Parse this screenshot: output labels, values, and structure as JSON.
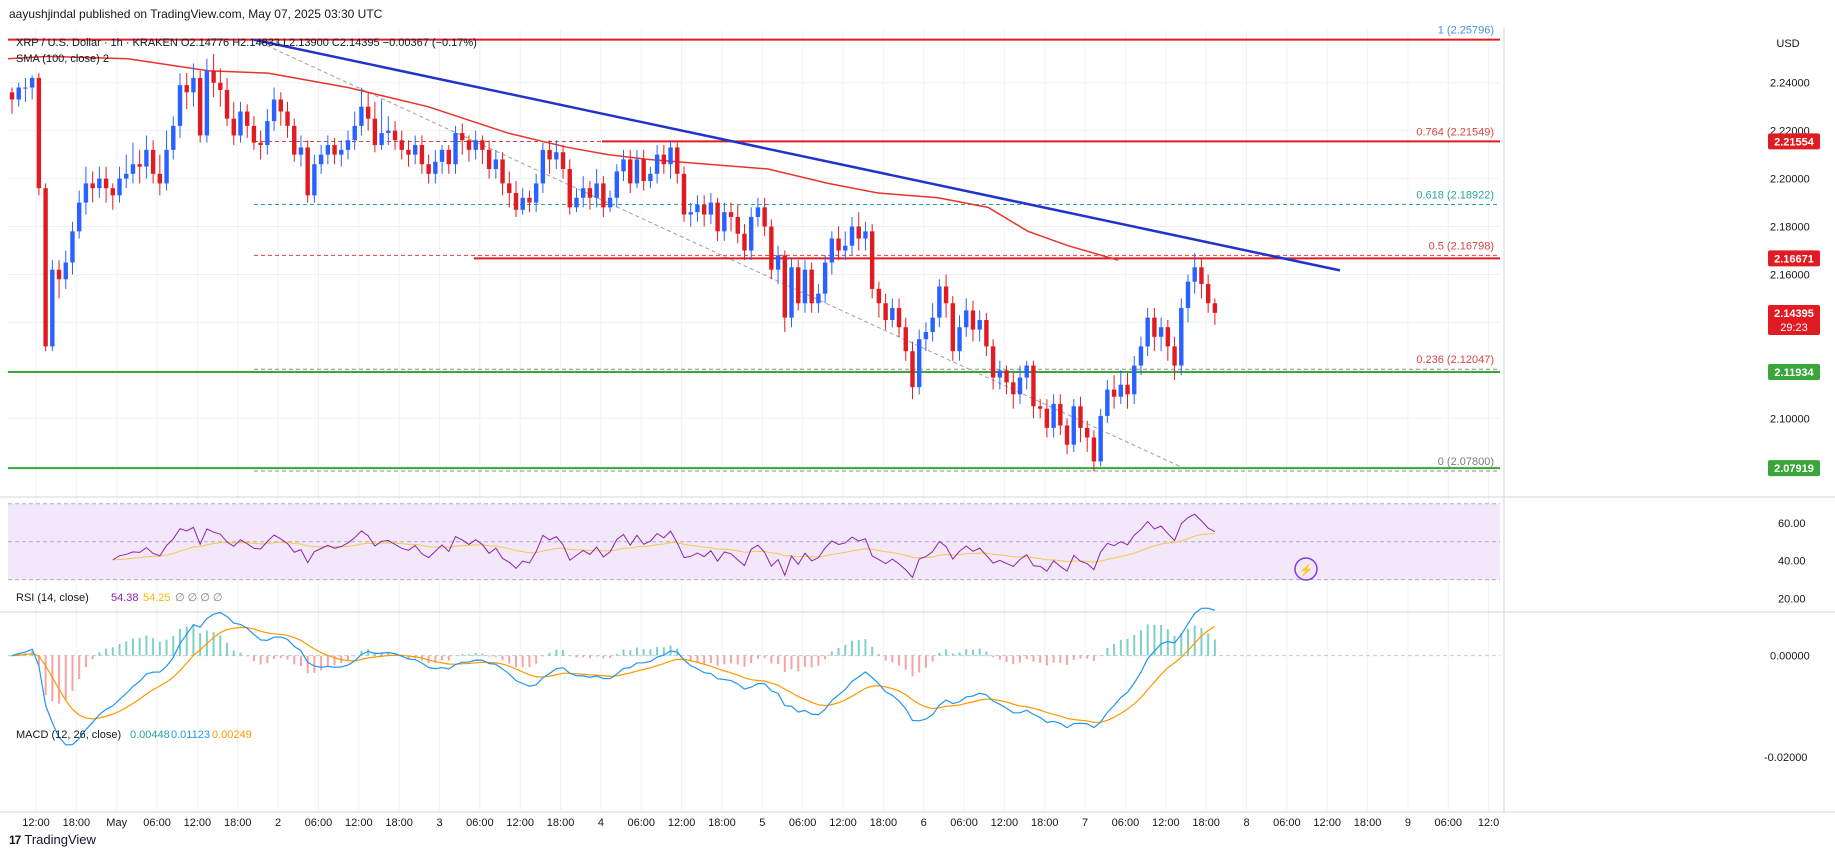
{
  "header": {
    "published": "aayushjindal published on TradingView.com, May 07, 2025 03:30 UTC"
  },
  "symbol_bar": {
    "pair": "XRP / U.S. Dollar · 1h · KRAKEN",
    "open": "O2.14776",
    "high": "H2.14833",
    "low": "L2.13900",
    "close": "C2.14395",
    "change": "−0.00367 (−0.17%)"
  },
  "sma_label": "SMA (100, close)  2",
  "rsi_label": {
    "name": "RSI (14, close)",
    "value": "54.38",
    "ma": "54.25",
    "extra": "∅ ∅ ∅ ∅"
  },
  "macd_label": {
    "name": "MACD (12, 26, close)",
    "v1": "0.00448",
    "v2": "0.01123",
    "v3": "0.00249"
  },
  "currency": "USD",
  "logo_text": "TradingView",
  "colors": {
    "up": "#2962ff",
    "down": "#e01b22",
    "sma": "#e8342b",
    "trend": "#2233cc",
    "resistance": "#e01b22",
    "support": "#3aa63a",
    "rsi_line": "#8e24aa",
    "rsi_ma": "#f2c94c",
    "macd_line": "#2196f3",
    "signal_line": "#ff9800",
    "fib": "#26a69a"
  },
  "chart_data": {
    "type": "candlestick",
    "title": "XRP / U.S. Dollar · 1h · KRAKEN",
    "ylim": [
      2.068,
      2.262
    ],
    "y_ticks": [
      "2.24000",
      "2.22000",
      "2.20000",
      "2.18000",
      "2.16000",
      "2.10000"
    ],
    "x_ticks": [
      "12:00",
      "18:00",
      "May",
      "06:00",
      "12:00",
      "18:00",
      "2",
      "06:00",
      "12:00",
      "18:00",
      "3",
      "06:00",
      "12:00",
      "18:00",
      "4",
      "06:00",
      "12:00",
      "18:00",
      "5",
      "06:00",
      "12:00",
      "18:00",
      "6",
      "06:00",
      "12:00",
      "18:00",
      "7",
      "06:00",
      "12:00",
      "18:00",
      "8",
      "06:00",
      "12:00",
      "18:00",
      "9",
      "06:00",
      "12:0"
    ],
    "candles": [
      [
        2.236,
        2.233,
        2.227,
        2.238
      ],
      [
        2.233,
        2.238,
        2.23,
        2.24
      ],
      [
        2.238,
        2.238,
        2.232,
        2.242
      ],
      [
        2.238,
        2.242,
        2.233,
        2.243
      ],
      [
        2.242,
        2.196,
        2.193,
        2.244
      ],
      [
        2.196,
        2.13,
        2.128,
        2.198
      ],
      [
        2.13,
        2.162,
        2.128,
        2.166
      ],
      [
        2.162,
        2.158,
        2.15,
        2.166
      ],
      [
        2.158,
        2.165,
        2.154,
        2.17
      ],
      [
        2.165,
        2.178,
        2.16,
        2.182
      ],
      [
        2.178,
        2.19,
        2.175,
        2.195
      ],
      [
        2.19,
        2.198,
        2.185,
        2.205
      ],
      [
        2.198,
        2.196,
        2.19,
        2.203
      ],
      [
        2.196,
        2.2,
        2.192,
        2.205
      ],
      [
        2.2,
        2.196,
        2.19,
        2.205
      ],
      [
        2.196,
        2.193,
        2.187,
        2.198
      ],
      [
        2.193,
        2.2,
        2.19,
        2.205
      ],
      [
        2.2,
        2.202,
        2.196,
        2.21
      ],
      [
        2.202,
        2.206,
        2.198,
        2.215
      ],
      [
        2.206,
        2.205,
        2.198,
        2.212
      ],
      [
        2.205,
        2.212,
        2.2,
        2.218
      ],
      [
        2.212,
        2.202,
        2.198,
        2.216
      ],
      [
        2.202,
        2.198,
        2.193,
        2.21
      ],
      [
        2.198,
        2.212,
        2.195,
        2.22
      ],
      [
        2.212,
        2.222,
        2.208,
        2.226
      ],
      [
        2.222,
        2.239,
        2.217,
        2.244
      ],
      [
        2.239,
        2.236,
        2.229,
        2.244
      ],
      [
        2.236,
        2.242,
        2.23,
        2.248
      ],
      [
        2.242,
        2.218,
        2.215,
        2.245
      ],
      [
        2.218,
        2.245,
        2.215,
        2.25
      ],
      [
        2.245,
        2.24,
        2.234,
        2.252
      ],
      [
        2.24,
        2.237,
        2.23,
        2.246
      ],
      [
        2.237,
        2.225,
        2.222,
        2.242
      ],
      [
        2.225,
        2.218,
        2.214,
        2.232
      ],
      [
        2.218,
        2.228,
        2.215,
        2.232
      ],
      [
        2.228,
        2.222,
        2.217,
        2.231
      ],
      [
        2.222,
        2.215,
        2.212,
        2.226
      ],
      [
        2.215,
        2.214,
        2.208,
        2.22
      ],
      [
        2.214,
        2.224,
        2.21,
        2.229
      ],
      [
        2.224,
        2.233,
        2.22,
        2.238
      ],
      [
        2.233,
        2.228,
        2.222,
        2.236
      ],
      [
        2.228,
        2.222,
        2.217,
        2.232
      ],
      [
        2.222,
        2.21,
        2.207,
        2.225
      ],
      [
        2.21,
        2.213,
        2.205,
        2.218
      ],
      [
        2.213,
        2.193,
        2.19,
        2.216
      ],
      [
        2.193,
        2.206,
        2.19,
        2.21
      ],
      [
        2.206,
        2.21,
        2.202,
        2.214
      ],
      [
        2.21,
        2.214,
        2.206,
        2.218
      ],
      [
        2.214,
        2.21,
        2.206,
        2.217
      ],
      [
        2.21,
        2.212,
        2.205,
        2.216
      ],
      [
        2.212,
        2.216,
        2.208,
        2.22
      ],
      [
        2.216,
        2.222,
        2.212,
        2.228
      ],
      [
        2.222,
        2.23,
        2.218,
        2.238
      ],
      [
        2.23,
        2.225,
        2.22,
        2.236
      ],
      [
        2.225,
        2.214,
        2.211,
        2.232
      ],
      [
        2.214,
        2.219,
        2.212,
        2.233
      ],
      [
        2.219,
        2.22,
        2.214,
        2.226
      ],
      [
        2.22,
        2.216,
        2.212,
        2.224
      ],
      [
        2.216,
        2.212,
        2.208,
        2.22
      ],
      [
        2.212,
        2.21,
        2.205,
        2.216
      ],
      [
        2.21,
        2.214,
        2.206,
        2.218
      ],
      [
        2.214,
        2.206,
        2.202,
        2.218
      ],
      [
        2.206,
        2.202,
        2.198,
        2.21
      ],
      [
        2.202,
        2.207,
        2.198,
        2.212
      ],
      [
        2.207,
        2.212,
        2.202,
        2.214
      ],
      [
        2.212,
        2.206,
        2.202,
        2.214
      ],
      [
        2.206,
        2.219,
        2.202,
        2.222
      ],
      [
        2.219,
        2.216,
        2.21,
        2.223
      ],
      [
        2.216,
        2.212,
        2.207,
        2.218
      ],
      [
        2.212,
        2.216,
        2.208,
        2.22
      ],
      [
        2.216,
        2.212,
        2.206,
        2.218
      ],
      [
        2.212,
        2.204,
        2.2,
        2.216
      ],
      [
        2.204,
        2.208,
        2.2,
        2.212
      ],
      [
        2.208,
        2.198,
        2.193,
        2.211
      ],
      [
        2.198,
        2.194,
        2.188,
        2.203
      ],
      [
        2.194,
        2.187,
        2.184,
        2.199
      ],
      [
        2.187,
        2.192,
        2.185,
        2.196
      ],
      [
        2.192,
        2.19,
        2.186,
        2.195
      ],
      [
        2.19,
        2.198,
        2.186,
        2.202
      ],
      [
        2.198,
        2.212,
        2.194,
        2.215
      ],
      [
        2.212,
        2.208,
        2.202,
        2.216
      ],
      [
        2.208,
        2.211,
        2.204,
        2.216
      ],
      [
        2.211,
        2.204,
        2.2,
        2.214
      ],
      [
        2.204,
        2.188,
        2.185,
        2.208
      ],
      [
        2.188,
        2.192,
        2.186,
        2.196
      ],
      [
        2.192,
        2.196,
        2.188,
        2.201
      ],
      [
        2.196,
        2.192,
        2.187,
        2.199
      ],
      [
        2.192,
        2.198,
        2.188,
        2.204
      ],
      [
        2.198,
        2.188,
        2.184,
        2.201
      ],
      [
        2.188,
        2.192,
        2.186,
        2.195
      ],
      [
        2.192,
        2.203,
        2.188,
        2.206
      ],
      [
        2.203,
        2.208,
        2.199,
        2.212
      ],
      [
        2.208,
        2.198,
        2.194,
        2.212
      ],
      [
        2.198,
        2.208,
        2.196,
        2.212
      ],
      [
        2.208,
        2.199,
        2.195,
        2.212
      ],
      [
        2.199,
        2.202,
        2.196,
        2.205
      ],
      [
        2.202,
        2.21,
        2.198,
        2.214
      ],
      [
        2.21,
        2.206,
        2.202,
        2.214
      ],
      [
        2.206,
        2.213,
        2.2,
        2.216
      ],
      [
        2.213,
        2.202,
        2.198,
        2.215
      ],
      [
        2.202,
        2.185,
        2.182,
        2.205
      ],
      [
        2.185,
        2.186,
        2.18,
        2.19
      ],
      [
        2.186,
        2.189,
        2.182,
        2.193
      ],
      [
        2.189,
        2.185,
        2.18,
        2.193
      ],
      [
        2.185,
        2.19,
        2.181,
        2.194
      ],
      [
        2.19,
        2.178,
        2.174,
        2.192
      ],
      [
        2.178,
        2.186,
        2.174,
        2.19
      ],
      [
        2.186,
        2.184,
        2.178,
        2.19
      ],
      [
        2.184,
        2.177,
        2.173,
        2.189
      ],
      [
        2.177,
        2.17,
        2.166,
        2.181
      ],
      [
        2.17,
        2.184,
        2.166,
        2.188
      ],
      [
        2.184,
        2.188,
        2.18,
        2.192
      ],
      [
        2.188,
        2.18,
        2.176,
        2.192
      ],
      [
        2.18,
        2.162,
        2.158,
        2.183
      ],
      [
        2.162,
        2.168,
        2.156,
        2.172
      ],
      [
        2.168,
        2.142,
        2.136,
        2.17
      ],
      [
        2.142,
        2.163,
        2.138,
        2.167
      ],
      [
        2.163,
        2.148,
        2.145,
        2.166
      ],
      [
        2.148,
        2.162,
        2.144,
        2.166
      ],
      [
        2.162,
        2.148,
        2.144,
        2.165
      ],
      [
        2.148,
        2.152,
        2.144,
        2.156
      ],
      [
        2.152,
        2.165,
        2.148,
        2.168
      ],
      [
        2.165,
        2.175,
        2.16,
        2.178
      ],
      [
        2.175,
        2.17,
        2.166,
        2.18
      ],
      [
        2.17,
        2.172,
        2.166,
        2.178
      ],
      [
        2.172,
        2.18,
        2.168,
        2.184
      ],
      [
        2.18,
        2.175,
        2.17,
        2.186
      ],
      [
        2.175,
        2.178,
        2.17,
        2.182
      ],
      [
        2.178,
        2.154,
        2.15,
        2.181
      ],
      [
        2.154,
        2.148,
        2.142,
        2.157
      ],
      [
        2.148,
        2.141,
        2.137,
        2.152
      ],
      [
        2.141,
        2.146,
        2.138,
        2.15
      ],
      [
        2.146,
        2.138,
        2.134,
        2.15
      ],
      [
        2.138,
        2.128,
        2.124,
        2.142
      ],
      [
        2.128,
        2.113,
        2.108,
        2.132
      ],
      [
        2.113,
        2.133,
        2.11,
        2.137
      ],
      [
        2.133,
        2.136,
        2.128,
        2.14
      ],
      [
        2.136,
        2.142,
        2.132,
        2.148
      ],
      [
        2.142,
        2.155,
        2.138,
        2.158
      ],
      [
        2.155,
        2.148,
        2.142,
        2.16
      ],
      [
        2.148,
        2.128,
        2.124,
        2.151
      ],
      [
        2.128,
        2.138,
        2.124,
        2.143
      ],
      [
        2.138,
        2.145,
        2.134,
        2.15
      ],
      [
        2.145,
        2.137,
        2.132,
        2.149
      ],
      [
        2.137,
        2.141,
        2.132,
        2.145
      ],
      [
        2.141,
        2.13,
        2.126,
        2.144
      ],
      [
        2.13,
        2.117,
        2.112,
        2.133
      ],
      [
        2.117,
        2.12,
        2.112,
        2.124
      ],
      [
        2.12,
        2.115,
        2.11,
        2.122
      ],
      [
        2.115,
        2.11,
        2.104,
        2.119
      ],
      [
        2.11,
        2.117,
        2.106,
        2.122
      ],
      [
        2.117,
        2.122,
        2.112,
        2.124
      ],
      [
        2.122,
        2.105,
        2.1,
        2.124
      ],
      [
        2.105,
        2.104,
        2.1,
        2.108
      ],
      [
        2.104,
        2.096,
        2.092,
        2.108
      ],
      [
        2.096,
        2.106,
        2.092,
        2.11
      ],
      [
        2.106,
        2.097,
        2.093,
        2.11
      ],
      [
        2.097,
        2.089,
        2.085,
        2.1
      ],
      [
        2.089,
        2.105,
        2.086,
        2.108
      ],
      [
        2.105,
        2.096,
        2.09,
        2.109
      ],
      [
        2.096,
        2.092,
        2.086,
        2.099
      ],
      [
        2.092,
        2.082,
        2.078,
        2.095
      ],
      [
        2.082,
        2.101,
        2.08,
        2.104
      ],
      [
        2.101,
        2.112,
        2.098,
        2.116
      ],
      [
        2.112,
        2.109,
        2.104,
        2.118
      ],
      [
        2.109,
        2.114,
        2.106,
        2.12
      ],
      [
        2.114,
        2.11,
        2.104,
        2.119
      ],
      [
        2.11,
        2.122,
        2.106,
        2.126
      ],
      [
        2.122,
        2.13,
        2.118,
        2.134
      ],
      [
        2.13,
        2.142,
        2.126,
        2.146
      ],
      [
        2.142,
        2.134,
        2.128,
        2.146
      ],
      [
        2.134,
        2.138,
        2.128,
        2.142
      ],
      [
        2.138,
        2.13,
        2.124,
        2.141
      ],
      [
        2.13,
        2.122,
        2.116,
        2.134
      ],
      [
        2.122,
        2.146,
        2.118,
        2.15
      ],
      [
        2.146,
        2.157,
        2.14,
        2.16
      ],
      [
        2.157,
        2.163,
        2.152,
        2.169
      ],
      [
        2.163,
        2.156,
        2.15,
        2.167
      ],
      [
        2.156,
        2.148,
        2.144,
        2.16
      ],
      [
        2.148,
        2.144,
        2.139,
        2.15
      ]
    ],
    "sma100": [
      [
        0,
        2.25
      ],
      [
        40,
        2.251
      ],
      [
        120,
        2.25
      ],
      [
        200,
        2.245
      ],
      [
        260,
        2.244
      ],
      [
        340,
        2.238
      ],
      [
        420,
        2.23
      ],
      [
        500,
        2.219
      ],
      [
        560,
        2.213
      ],
      [
        600,
        2.21
      ],
      [
        640,
        2.208
      ],
      [
        700,
        2.206
      ],
      [
        760,
        2.204
      ],
      [
        820,
        2.198
      ],
      [
        870,
        2.194
      ],
      [
        930,
        2.192
      ],
      [
        980,
        2.188
      ],
      [
        1020,
        2.178
      ],
      [
        1060,
        2.172
      ],
      [
        1110,
        2.166
      ]
    ],
    "rsi": {
      "ylim": [
        14,
        72
      ],
      "levels": [
        60,
        40,
        20
      ],
      "band": [
        30,
        70
      ]
    },
    "macd": {
      "ylim": [
        -0.03,
        0.008
      ],
      "ticks": [
        "0.00000",
        "-0.02000"
      ]
    },
    "levels": {
      "fib": [
        {
          "ratio": "1",
          "price": 2.25796,
          "label": "1 (2.25796)"
        },
        {
          "ratio": "0.764",
          "price": 2.21549,
          "label": "0.764 (2.21549)"
        },
        {
          "ratio": "0.618",
          "price": 2.18922,
          "label": "0.618 (2.18922)"
        },
        {
          "ratio": "0.5",
          "price": 2.16798,
          "label": "0.5 (2.16798)"
        },
        {
          "ratio": "0.236",
          "price": 2.12047,
          "label": "0.236 (2.12047)"
        },
        {
          "ratio": "0",
          "price": 2.078,
          "label": "0 (2.07800)"
        }
      ],
      "resistance": [
        2.21554,
        2.16671
      ],
      "support": [
        2.11934,
        2.07919
      ],
      "current": {
        "price": "2.14395",
        "countdown": "29:23"
      }
    }
  }
}
